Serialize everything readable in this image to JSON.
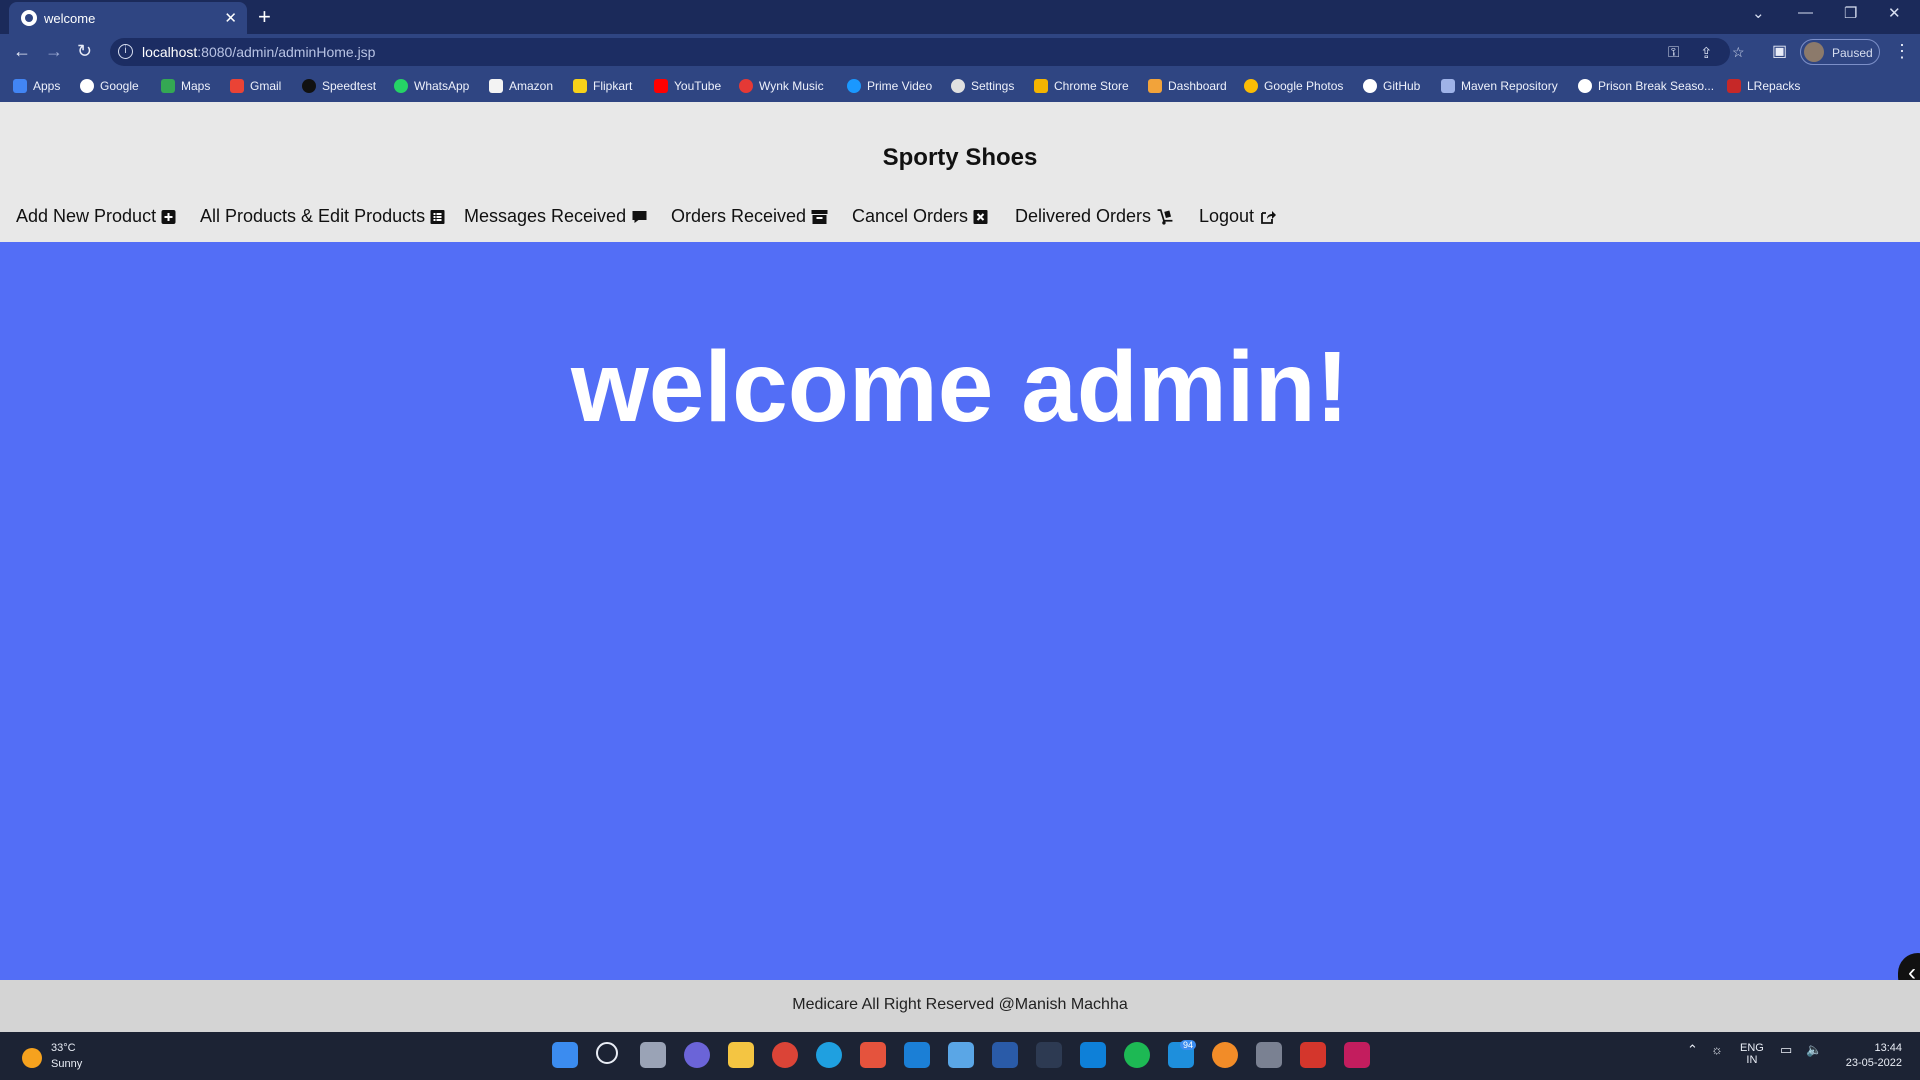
{
  "browser": {
    "tab_title": "welcome",
    "url_host": "localhost",
    "url_path": ":8080/admin/adminHome.jsp",
    "profile_label": "Paused",
    "bookmarks": [
      "Apps",
      "Google",
      "Maps",
      "Gmail",
      "Speedtest",
      "WhatsApp",
      "Amazon",
      "Flipkart",
      "YouTube",
      "Wynk Music",
      "Prime Video",
      "Settings",
      "Chrome Store",
      "Dashboard",
      "Google Photos",
      "GitHub",
      "Maven Repository",
      "Prison Break Seaso...",
      "LRepacks"
    ]
  },
  "site": {
    "brand": "Sporty Shoes",
    "menu": [
      "Add New Product",
      "All Products & Edit Products",
      "Messages Received",
      "Orders Received",
      "Cancel Orders",
      "Delivered Orders",
      "Logout"
    ],
    "welcome": "welcome admin!",
    "footer": "Medicare All Right Reserved @Manish Machha"
  },
  "taskbar": {
    "temp": "33°C",
    "condition": "Sunny",
    "badge": "94",
    "lang1": "ENG",
    "lang2": "IN",
    "time": "13:44",
    "date": "23-05-2022"
  },
  "colors": {
    "page_bg": "#536ef6",
    "header_bg": "#e8e8e8",
    "footer_bg": "#d4d4d4",
    "chrome_bg": "#2f4582"
  }
}
